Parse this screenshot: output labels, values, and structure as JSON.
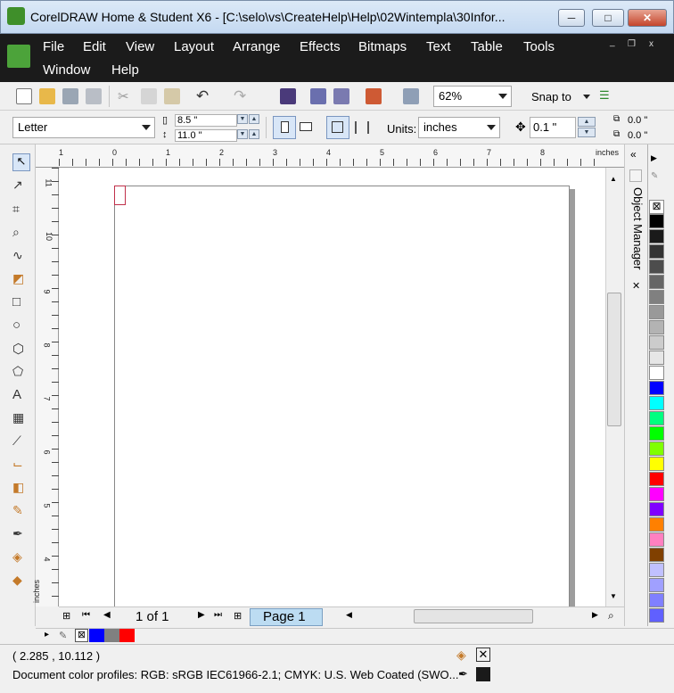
{
  "window": {
    "title": "CorelDRAW Home & Student X6 - [C:\\selo\\vs\\CreateHelp\\Help\\02Wintempla\\30Infor...",
    "minimize": "─",
    "maximize": "□",
    "close": "✕"
  },
  "menu": {
    "items": [
      "File",
      "Edit",
      "View",
      "Layout",
      "Arrange",
      "Effects",
      "Bitmaps",
      "Text",
      "Table",
      "Tools"
    ],
    "items2": [
      "Window",
      "Help"
    ],
    "mdi_minimize": "_",
    "mdi_restore": "❐",
    "mdi_close": "x"
  },
  "toolbar": {
    "zoom_value": "62%",
    "snap_label": "Snap to"
  },
  "propertybar": {
    "page_size": "Letter",
    "width": "8.5 \"",
    "height": "11.0 \"",
    "units_label": "Units:",
    "units_value": "inches",
    "nudge_value": "0.1 \"",
    "dup_x": "0.0 \"",
    "dup_y": "0.0 \""
  },
  "ruler": {
    "unit_label": "inches",
    "top_ticks": [
      "1",
      "0",
      "1",
      "2",
      "3",
      "4",
      "5",
      "6",
      "7",
      "8"
    ],
    "left_ticks": [
      "11",
      "10",
      "9",
      "8",
      "7",
      "6",
      "5",
      "4"
    ],
    "left_unit": "inches"
  },
  "docker": {
    "title": "Object Manager"
  },
  "palette": {
    "colors": [
      "#000000",
      "#1a1a1a",
      "#333333",
      "#4d4d4d",
      "#666666",
      "#808080",
      "#999999",
      "#b3b3b3",
      "#cccccc",
      "#e6e6e6",
      "#ffffff",
      "#0000ff",
      "#00ffff",
      "#00ff80",
      "#00ff00",
      "#80ff00",
      "#ffff00",
      "#ff0000",
      "#ff00ff",
      "#8000ff",
      "#ff8000",
      "#ff80c0",
      "#804000",
      "#c0c0ff",
      "#a0a0ff",
      "#8080ff",
      "#6060ff"
    ]
  },
  "pagebar": {
    "page_count": "1 of 1",
    "page_tab": "Page 1"
  },
  "doc_palette": {
    "colors": [
      "#0000ff",
      "#808080",
      "#ff0000"
    ]
  },
  "status": {
    "coords": "( 2.285 , 10.112 )",
    "profiles": "Document color profiles: RGB: sRGB IEC61966-2.1; CMYK: U.S. Web Coated (SWO..."
  }
}
